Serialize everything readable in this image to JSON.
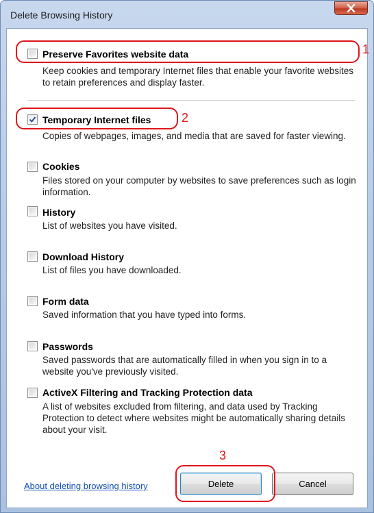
{
  "window": {
    "title": "Delete Browsing History",
    "close_symbol": "x"
  },
  "items": [
    {
      "label": "Preserve Favorites website data",
      "checked": false,
      "description": "Keep cookies and temporary Internet files that enable your favorite websites to retain preferences and display faster."
    },
    {
      "label": "Temporary Internet files",
      "checked": true,
      "description": "Copies of webpages, images, and media that are saved for faster viewing."
    },
    {
      "label": "Cookies",
      "checked": false,
      "description": "Files stored on your computer by websites to save preferences such as login information."
    },
    {
      "label": "History",
      "checked": false,
      "description": "List of websites you have visited."
    },
    {
      "label": "Download History",
      "checked": false,
      "description": "List of files you have downloaded."
    },
    {
      "label": "Form data",
      "checked": false,
      "description": "Saved information that you have typed into forms."
    },
    {
      "label": "Passwords",
      "checked": false,
      "description": "Saved passwords that are automatically filled in when you sign in to a website you've previously visited."
    },
    {
      "label": "ActiveX Filtering and Tracking Protection data",
      "checked": false,
      "description": "A list of websites excluded from filtering, and data used by Tracking Protection to detect where websites might be automatically sharing details about your visit."
    }
  ],
  "footer": {
    "link": "About deleting browsing history",
    "delete_label": "Delete",
    "cancel_label": "Cancel"
  },
  "annotations": {
    "marker1": "1",
    "marker2": "2",
    "marker3": "3"
  },
  "colors": {
    "annotation_red": "#e0141a",
    "link_blue": "#0f4fb3",
    "frame_blue": "#b6cbe6"
  }
}
